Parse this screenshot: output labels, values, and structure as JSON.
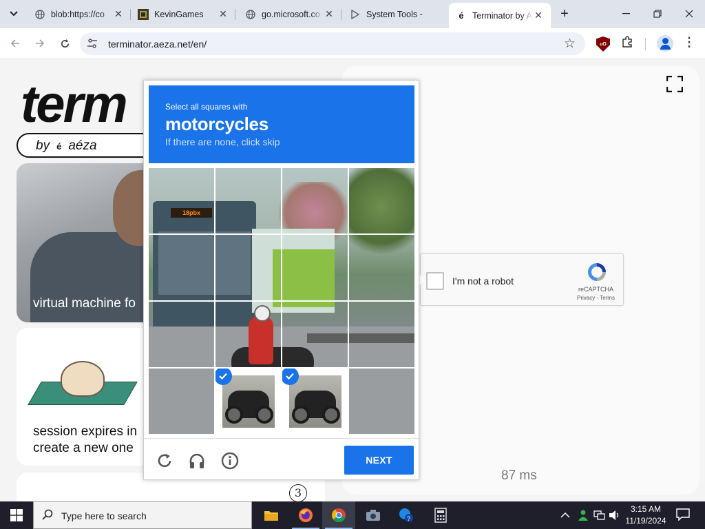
{
  "browser": {
    "tabs": [
      {
        "title": "blob:https://co",
        "icon": "globe-icon"
      },
      {
        "title": "KevinGames",
        "icon": "kevingames-icon"
      },
      {
        "title": "go.microsoft.co",
        "icon": "globe-icon"
      },
      {
        "title": "System Tools -",
        "icon": "play-icon"
      },
      {
        "title": "Terminator by A",
        "icon": "aeza-icon",
        "active": true
      }
    ],
    "url": "terminator.aeza.net/en/"
  },
  "page": {
    "logo": "term",
    "byline_by": "by",
    "byline_e": "é",
    "byline_brand": "aéza",
    "hero_caption": "virtual machine fo",
    "session_line1": "session expires in",
    "session_line2": "create a new one",
    "latency": "87 ms"
  },
  "recaptcha_checkbox": {
    "label": "I'm not a robot",
    "brand": "reCAPTCHA",
    "links": "Privacy - Terms"
  },
  "challenge": {
    "instruction": "Select all squares with",
    "target": "motorcycles",
    "hint": "If there are none, click skip",
    "bus_sign": "18pbx",
    "selected_cells": [
      13,
      14
    ],
    "next_label": "NEXT"
  },
  "annotation": "3",
  "taskbar": {
    "search_placeholder": "Type here to search",
    "time": "3:15 AM",
    "date": "11/19/2024"
  },
  "colors": {
    "accent": "#1a73e8",
    "taskbar": "#1e1f2b"
  }
}
